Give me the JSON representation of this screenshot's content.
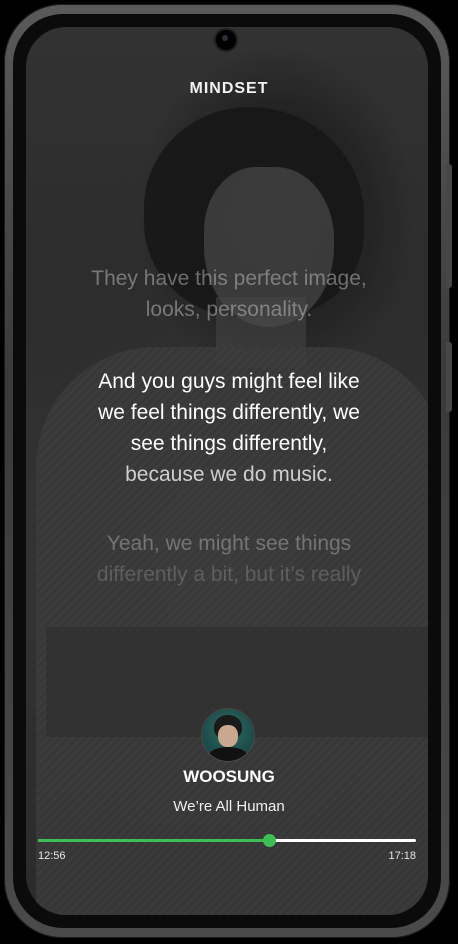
{
  "app": {
    "title": "MINDSET"
  },
  "lyrics": {
    "past": [
      "They have this perfect image,",
      "looks, personality."
    ],
    "current": [
      "And you guys might feel like",
      "we feel things differently, we",
      "see things differently,",
      "because we do music."
    ],
    "next": [
      "Yeah, we might see things",
      "differently a bit, but it’s really"
    ]
  },
  "now_playing": {
    "artist": "WOOSUNG",
    "title": "We’re All Human",
    "elapsed": "12:56",
    "total": "17:18",
    "progress_fraction": 0.61
  },
  "colors": {
    "accent": "#3dbf53",
    "track": "#ffffff",
    "text": "#ffffff"
  },
  "icons": {
    "avatar": "artist-avatar-photo"
  }
}
